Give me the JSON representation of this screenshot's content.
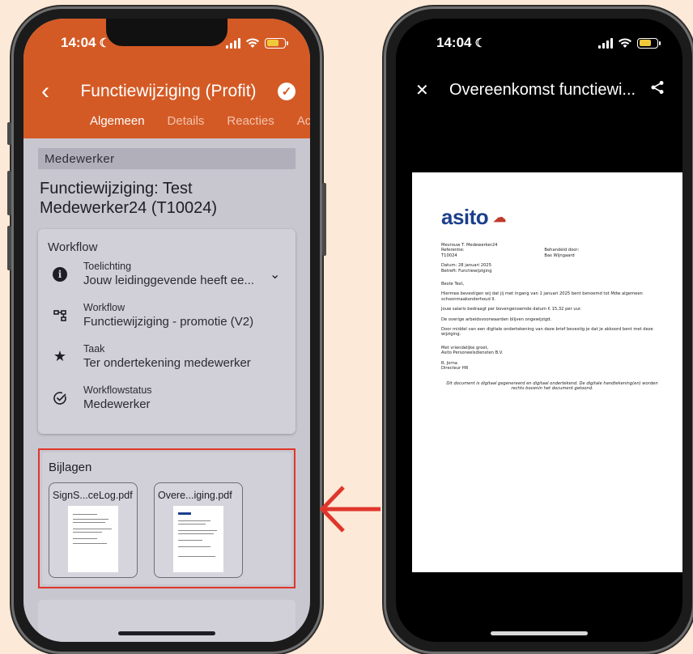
{
  "left_phone": {
    "status": {
      "time": "14:04"
    },
    "appbar": {
      "title": "Functiewijziging (Profit)",
      "tabs": [
        "Algemeen",
        "Details",
        "Reacties",
        "Actielog"
      ]
    },
    "section_label": "Medewerker",
    "heading": "Functiewijziging: Test Medewerker24 (T10024)",
    "workflow_card": {
      "title": "Workflow",
      "rows": [
        {
          "icon": "info-icon",
          "label": "Toelichting",
          "value": "Jouw leidinggevende heeft ee..."
        },
        {
          "icon": "workflow-icon",
          "label": "Workflow",
          "value": "Functiewijziging - promotie (V2)"
        },
        {
          "icon": "star-icon",
          "label": "Taak",
          "value": "Ter ondertekening medewerker"
        },
        {
          "icon": "check-circle-icon",
          "label": "Workflowstatus",
          "value": "Medewerker"
        }
      ]
    },
    "attachments": {
      "title": "Bijlagen",
      "files": [
        {
          "name": "SignS...ceLog.pdf"
        },
        {
          "name": "Overe...iging.pdf"
        }
      ]
    }
  },
  "right_phone": {
    "status": {
      "time": "14:04"
    },
    "title": "Overeenkomst functiewi...",
    "document": {
      "logo": "asito",
      "recipient": "Mevrouw T. Medewerker24",
      "reference_label": "Referentie:",
      "reference": "T10024",
      "handled_label": "Behandeld door:",
      "handled_by": "Bas Wijngaard",
      "date": "Datum: 28 januari 2025",
      "subject": "Betreft: Functiewijziging",
      "greeting": "Beste Test,",
      "p1": "Hiermee bevestigen wij dat jij met ingang van 1 januari 2025 bent benoemd tot Mdw algemeen schoonmaakonderhoud II.",
      "p2": "Jouw salaris bedraagt per bovengenoemde datum € 15,32 per uur.",
      "p3": "De overige arbeidsvoorwaarden blijven ongewijzigd.",
      "p4": "Door middel van een digitale ondertekening van deze brief bevestig je dat je akkoord bent met deze wijziging.",
      "closing": "Met vriendelijke groet,",
      "company": "Asito Personeelsdiensten B.V.",
      "signer": "R. Jorna",
      "signer_title": "Directeur HR",
      "footer": "Dit document is digitaal gegenereerd en digitaal ondertekend. De digitale handtekening(en) worden rechts bovenin het document getoond."
    }
  },
  "colors": {
    "appbar": "#d45a25",
    "highlight": "#e0352b",
    "background": "#fde9d7"
  }
}
